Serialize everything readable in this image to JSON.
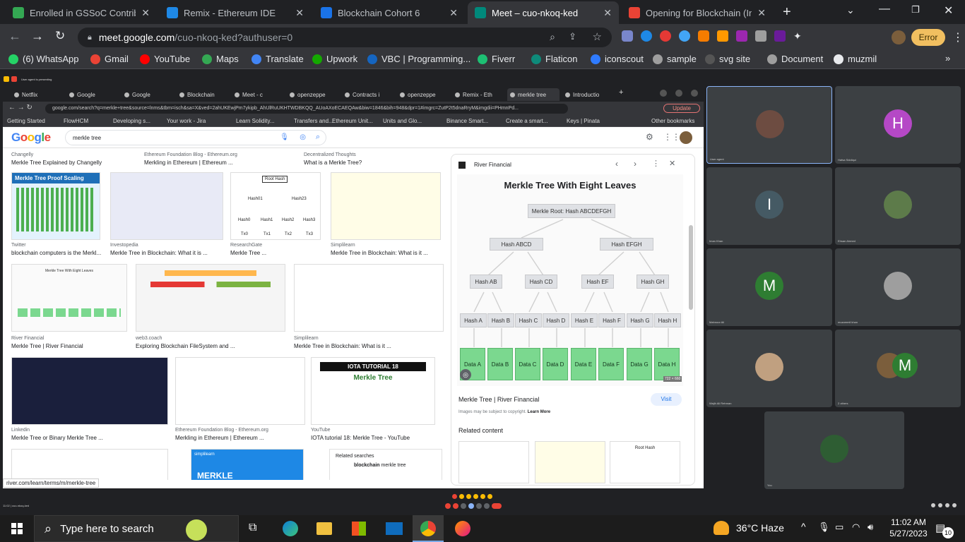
{
  "browser": {
    "tabs": [
      {
        "label": "Enrolled in GSSoC Contributo",
        "color": "#34a853"
      },
      {
        "label": "Remix - Ethereum IDE",
        "color": "#1e88e5"
      },
      {
        "label": "Blockchain Cohort 6",
        "color": "#1a73e8"
      },
      {
        "label": "Meet – cuo-nkoq-ked",
        "color": "#00897b",
        "active": true
      },
      {
        "label": "Opening for Blockchain (Inte",
        "color": "#ea4335"
      }
    ],
    "url_domain": "meet.google.com",
    "url_path": "/cuo-nkoq-ked?authuser=0",
    "error_label": "Error",
    "bookmarks": [
      {
        "label": "(6) WhatsApp",
        "color": "#25d366"
      },
      {
        "label": "Gmail",
        "color": "#ea4335"
      },
      {
        "label": "YouTube",
        "color": "#ff0000"
      },
      {
        "label": "Maps",
        "color": "#34a853"
      },
      {
        "label": "Translate",
        "color": "#4285f4"
      },
      {
        "label": "Upwork",
        "color": "#14a800"
      },
      {
        "label": "VBC | Programming...",
        "color": "#1565c0"
      },
      {
        "label": "Fiverr",
        "color": "#1dbf73"
      },
      {
        "label": "Flaticon",
        "color": "#0e8a7a"
      },
      {
        "label": "iconscout",
        "color": "#2f7bff"
      },
      {
        "label": "sample",
        "color": "#9e9e9e"
      },
      {
        "label": "svg site",
        "color": "#555"
      },
      {
        "label": "Document",
        "color": "#9e9e9e"
      },
      {
        "label": "muzmil",
        "color": "#e8eaed"
      }
    ]
  },
  "meet": {
    "presenter_label": "User agent is presenting",
    "shared": {
      "tabs": [
        "Netflix",
        "Google",
        "Google",
        "Blockchain",
        "Meet - c",
        "openzeppe",
        "Contracts i",
        "openzeppe",
        "Remix - Eth",
        "merkle tree",
        "Introductio"
      ],
      "url": "google.com/search?q=merkle+tree&source=lnms&tbm=isch&sa=X&ved=2ahUKEwjPm7ykipb_AhUlRuUKHTWDBKQQ_AUoAXoECAEQAw&biw=1846&bih=948&dpr=1#imgrc=ZutP2t5dnaRryM&imgdii=PHmnPd...",
      "update_label": "Update",
      "bookmarks": [
        "Getting Started",
        "FlowHCM",
        "Developing s...",
        "Your work - Jira",
        "Learn Solidity...",
        "Transfers and...",
        "Ethereum Unit...",
        "Units and Glo...",
        "Binance Smart...",
        "Create a smart...",
        "Keys | Pinata",
        "Other bookmarks"
      ],
      "logo": "Google",
      "search_query": "merkle tree",
      "results_row0": [
        {
          "source": "Changelly",
          "title": "Merkle Tree Explained by Changelly"
        },
        {
          "source": "Ethereum Foundation Blog - Ethereum.org",
          "title": "Merkling in Ethereum | Ethereum ..."
        },
        {
          "source": "Decentralized Thoughts",
          "title": "What is a Merkle Tree?"
        }
      ],
      "results_row1": [
        {
          "source": "Twitter",
          "title": "blockchain computers is the Merkl..."
        },
        {
          "source": "Investopedia",
          "title": "Merkle Tree in Blockchain: What it is ..."
        },
        {
          "source": "ResearchGate",
          "title": "Merkle Tree ..."
        },
        {
          "source": "Simplilearn",
          "title": "Merkle Tree in Blockchain: What is it ..."
        }
      ],
      "results_row2": [
        {
          "source": "River Financial",
          "title": "Merkle Tree | River Financial"
        },
        {
          "source": "web3.coach",
          "title": "Exploring Blockchain FileSystem and ..."
        },
        {
          "source": "Simplilearn",
          "title": "Merkle Tree in Blockchain: What is it ..."
        }
      ],
      "results_row3": [
        {
          "source": "Linkedin",
          "title": "Merkle Tree or Binary Merkle Tree ..."
        },
        {
          "source": "Ethereum Foundation Blog - Ethereum.org",
          "title": "Merkling in Ethereum | Ethereum ..."
        },
        {
          "source": "YouTube",
          "title": "IOTA tutorial 18: Merkle Tree - YouTube"
        }
      ],
      "thumb_texts": {
        "proof_scaling": "Merkle Tree Proof Scaling",
        "root_hash": "Root Hash",
        "hashes": [
          "Hash01",
          "Hash23",
          "Hash0",
          "Hash1",
          "Hash2",
          "Hash3",
          "Tx0",
          "Tx1",
          "Tx2",
          "Tx3"
        ],
        "eight_leaves": "Merkle Tree With Eight Leaves",
        "iota": "IOTA TUTORIAL 18",
        "iota_sub": "Merkle Tree",
        "simplilearn": "simplilearn",
        "merkle": "MERKLE",
        "related_searches": "Related searches",
        "related_bold": "blockchain",
        "related_rest": " merkle tree"
      },
      "status_url": "river.com/learn/terms/m/merkle-tree",
      "panel": {
        "source": "River Financial",
        "title": "Merkle Tree With Eight Leaves",
        "root": "Merkle Root: Hash ABCDEFGH",
        "level2": [
          "Hash ABCD",
          "Hash EFGH"
        ],
        "level3": [
          "Hash AB",
          "Hash CD",
          "Hash EF",
          "Hash GH"
        ],
        "level4": [
          "Hash A",
          "Hash B",
          "Hash C",
          "Hash D",
          "Hash E",
          "Hash F",
          "Hash G",
          "Hash H"
        ],
        "leaves": [
          "Data A",
          "Data B",
          "Data C",
          "Data D",
          "Data E",
          "Data F",
          "Data G",
          "Data H"
        ],
        "dims": "722 × 660",
        "caption": "Merkle Tree | River Financial",
        "visit": "Visit",
        "copyright": "Images may be subject to copyright.",
        "learn_more": "Learn More",
        "related": "Related content"
      }
    },
    "participants": [
      {
        "name": "User agent",
        "type": "photo",
        "color": "#6d4c41"
      },
      {
        "name": "Hafsa Siddiqui",
        "type": "letter",
        "letter": "H",
        "color": "#b548c6"
      },
      {
        "name": "Iman Khan",
        "type": "letter",
        "letter": "I",
        "color": "#455a64"
      },
      {
        "name": "Ehsan Ahmed",
        "type": "photo",
        "color": "#5d7b4a"
      },
      {
        "name": "Mahnoor Ali",
        "type": "letter",
        "letter": "M",
        "color": "#2e7d32"
      },
      {
        "name": "muzammil khan",
        "type": "photo",
        "color": "#9e9e9e"
      },
      {
        "name": "Wajih Ali Rehman",
        "type": "photo",
        "color": "#c0a080"
      },
      {
        "name": "2 others",
        "type": "pair",
        "letter": "M",
        "color": "#2e7d32"
      },
      {
        "name": "You",
        "type": "photo",
        "color": "#2e5d33"
      }
    ],
    "meeting_code": "11:02 | cuo-nkoq-ked"
  },
  "taskbar": {
    "search_placeholder": "Type here to search",
    "weather": "36°C  Haze",
    "time": "11:02 AM",
    "date": "5/27/2023",
    "notifications": "10"
  }
}
